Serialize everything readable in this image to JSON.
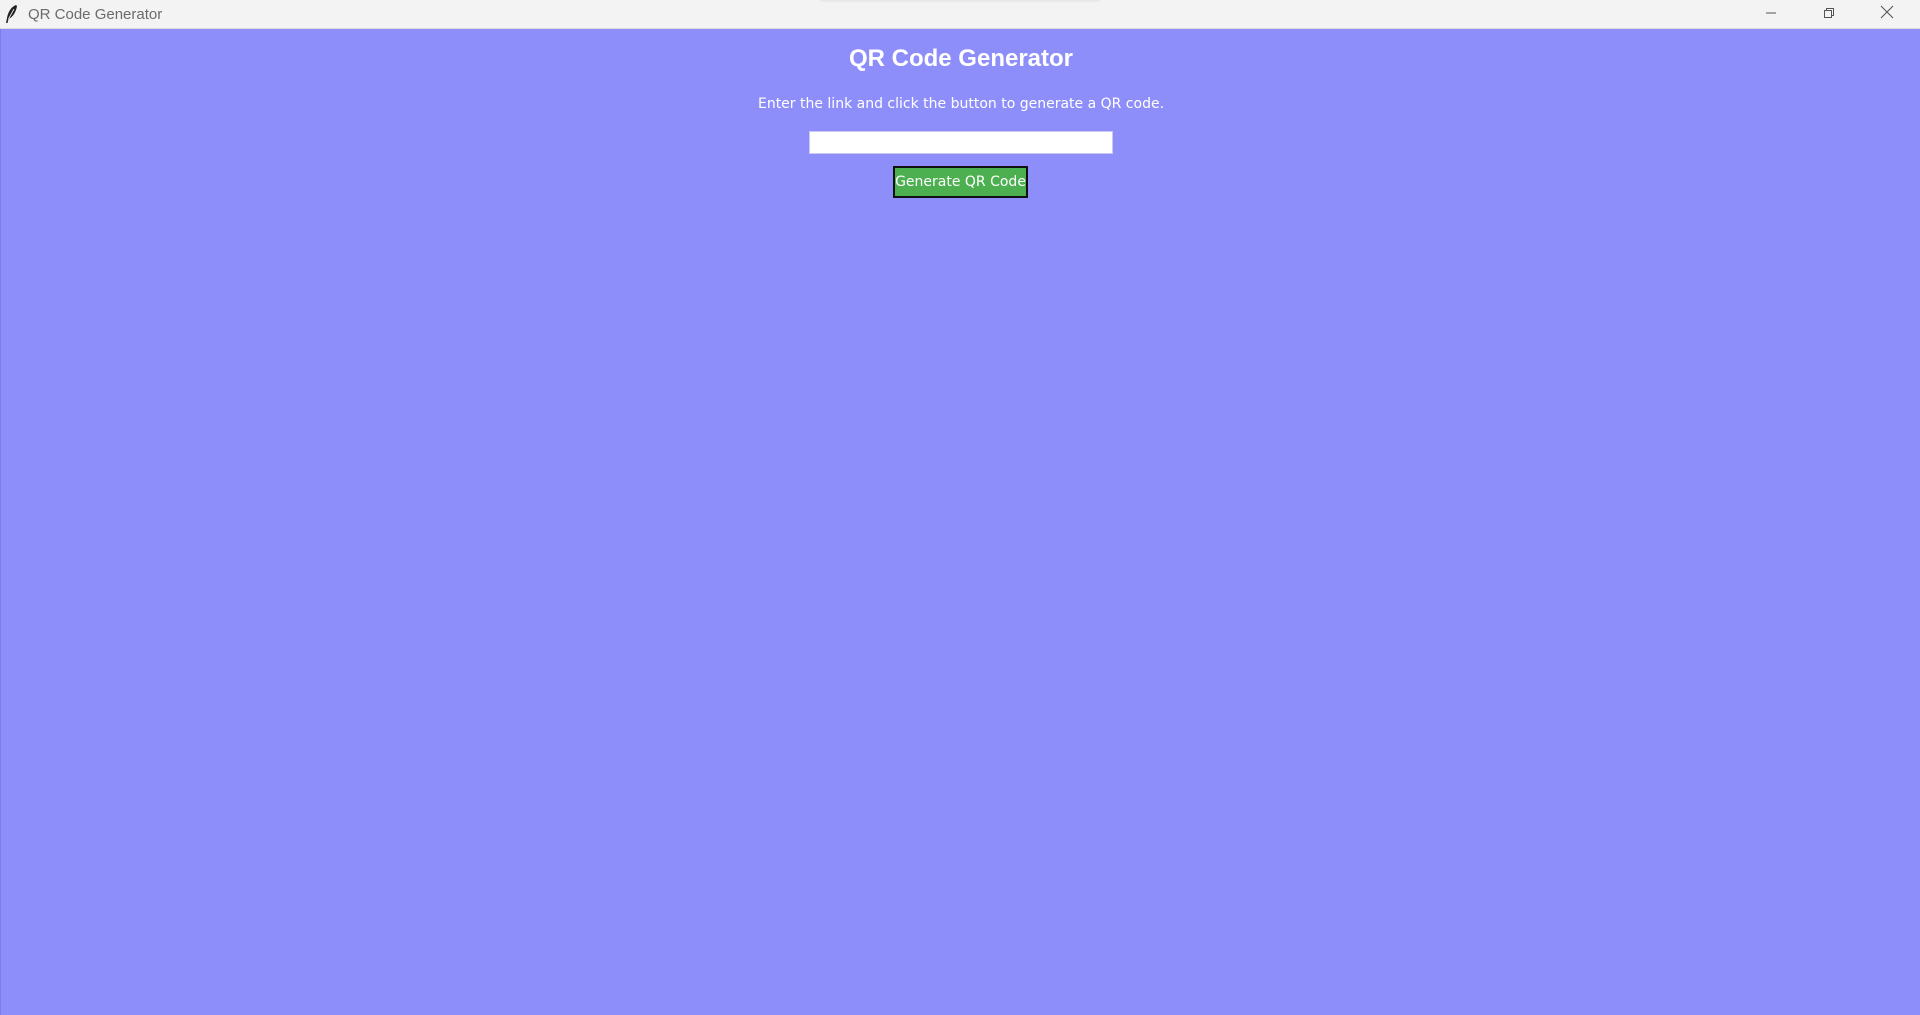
{
  "window": {
    "title": "QR Code Generator",
    "icon": "feather-icon",
    "controls": {
      "minimize_icon": "minimize-icon",
      "restore_icon": "restore-icon",
      "close_icon": "close-icon"
    }
  },
  "app": {
    "heading": "QR Code Generator",
    "instruction": "Enter the link and click the button to generate a QR code.",
    "link_input": {
      "value": "",
      "placeholder": ""
    },
    "generate_button_label": "Generate QR Code"
  },
  "colors": {
    "background": "#8e8efa",
    "button": "#4caf50",
    "text": "#ffffff"
  }
}
